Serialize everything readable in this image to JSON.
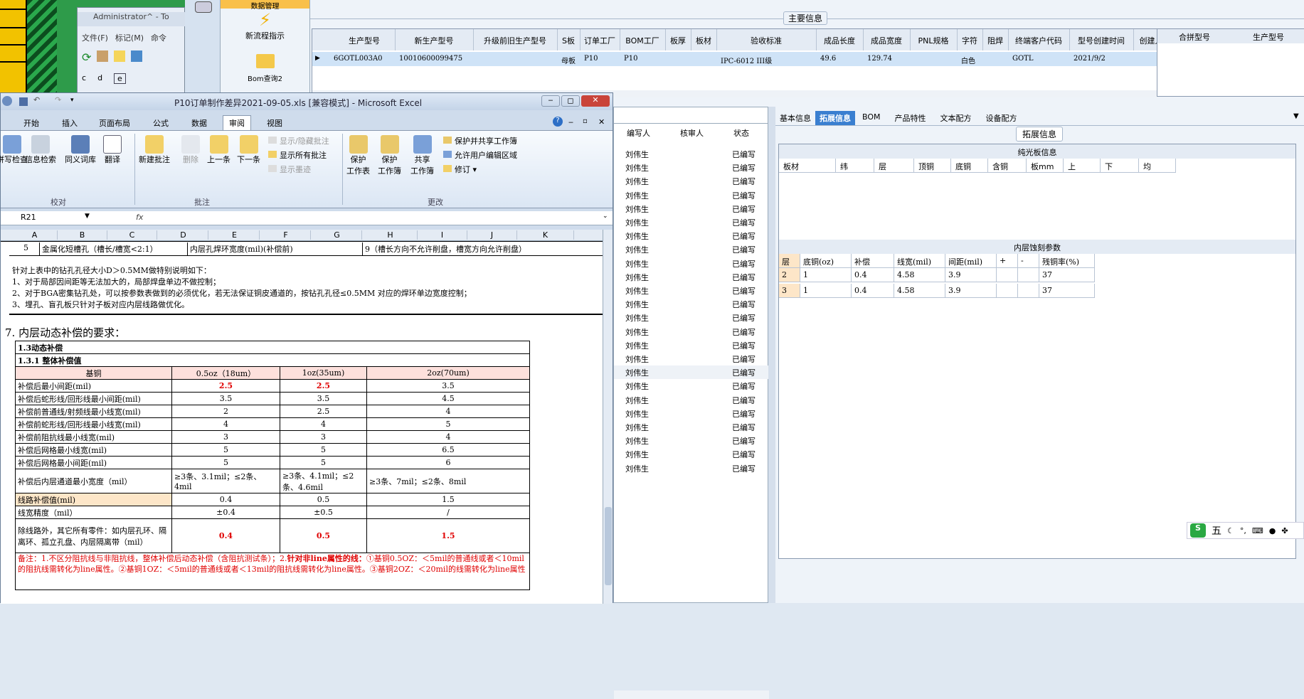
{
  "left_app": {
    "title": "Administrator^ - To",
    "menu": [
      "文件(F)",
      "标记(M)",
      "命令"
    ],
    "drives": [
      "c",
      "d",
      "e"
    ],
    "toolbox": {
      "top": "数据管理",
      "items": [
        "新流程指示",
        "Bom查询2"
      ]
    }
  },
  "main_info": {
    "section_title": "主要信息",
    "headers": [
      "生产型号",
      "新生产型号",
      "升级前旧生产型号",
      "S板",
      "订单工厂",
      "BOM工厂",
      "板厚",
      "板材",
      "验收标准",
      "成品长度",
      "成品宽度",
      "PNL规格",
      "字符",
      "阻焊",
      "终端客户代码",
      "型号创建时间",
      "创建人"
    ],
    "row": [
      "6GOTL003A0",
      "10010600099475",
      "",
      "母板",
      "P10",
      "P10",
      "",
      "",
      "IPC-6012 III级",
      "49.6",
      "129.74",
      "",
      "白色",
      "",
      "GOTL",
      "2021/9/2",
      ""
    ],
    "side_headers": [
      "合拼型号",
      "生产型号"
    ]
  },
  "status_panel": {
    "headers": [
      "编写人",
      "核审人",
      "状态"
    ],
    "writer": "刘伟生",
    "status": "已编写",
    "row_count": 24
  },
  "right_panel": {
    "tabs": [
      "基本信息",
      "拓展信息",
      "BOM",
      "产品特性",
      "文本配方",
      "设备配方"
    ],
    "section_title": "拓展信息",
    "plain_board": {
      "title": "纯光板信息",
      "headers": [
        "板材",
        "纬",
        "层",
        "顶铜",
        "底铜",
        "含铜",
        "板mm",
        "上",
        "下",
        "均"
      ]
    },
    "inner": {
      "title": "内层蚀刻参数",
      "headers": [
        "层",
        "底铜(oz)",
        "补偿",
        "线宽(mil)",
        "间距(mil)",
        "+",
        "-",
        "残铜率(%)"
      ],
      "rows": [
        [
          "2",
          "1",
          "0.4",
          "4.58",
          "3.9",
          "",
          "",
          "37"
        ],
        [
          "3",
          "1",
          "0.4",
          "4.58",
          "3.9",
          "",
          "",
          "37"
        ]
      ]
    }
  },
  "excel": {
    "title": "P10订单制作差异2021-09-05.xls [兼容模式] - Microsoft Excel",
    "tabs": [
      "开始",
      "插入",
      "页面布局",
      "公式",
      "数据",
      "审阅",
      "视图"
    ],
    "active_tab": "审阅",
    "groups": {
      "g1": "校对",
      "g2": "批注",
      "g3": "更改"
    },
    "ribbon": {
      "spell": "拼写检查",
      "research": "信息检索",
      "thesaurus": "同义词库",
      "translate": "翻译",
      "new_comment": "新建批注",
      "delete": "删除",
      "prev": "上一条",
      "next": "下一条",
      "show_hide": "显示/隐藏批注",
      "show_all": "显示所有批注",
      "show_ink": "显示墨迹",
      "protect_sheet": "保护\n工作表",
      "protect_wb": "保护\n工作簿",
      "share_wb": "共享\n工作簿",
      "protect_share": "保护并共享工作簿",
      "allow_edit": "允许用户编辑区域",
      "track": "修订"
    },
    "name_box": "R21",
    "fx": "fx",
    "cols": [
      "A",
      "B",
      "C",
      "D",
      "E",
      "F",
      "G",
      "H",
      "I",
      "J",
      "K"
    ],
    "row5": {
      "num": "5",
      "c1": "金属化短槽孔（槽长/槽宽<2:1）",
      "c2": "内层孔焊环宽度(mil)(补偿前)",
      "c3": "9（槽长方向不允许削盘，槽宽方向允许削盘）"
    },
    "notes": [
      "针对上表中的钻孔孔径大小D＞0.5MM做特别说明如下：",
      "1、对于局部因间距等无法加大的，局部焊盘单边不做控制；",
      "2、对于BGA密集钻孔处，可以按参数表做到的必须优化，若无法保证铜皮通道的，按钻孔孔径≤0.5MM 对应的焊环单边宽度控制；",
      "3、埋孔、盲孔板只针对子板对应内层线路做优化。"
    ],
    "section7": "7. 内层动态补偿的要求：",
    "t_title1": "1.3动态补偿",
    "t_title2": "1.3.1 整体补偿值",
    "t_head": [
      "基铜",
      "0.5oz（18um）",
      "1oz(35um)",
      "2oz(70um)"
    ],
    "t_rows": [
      [
        "补偿后最小间距(mil)",
        "2.5",
        "2.5",
        "3.5"
      ],
      [
        "补偿后蛇形线/回形线最小间距(mil)",
        "3.5",
        "3.5",
        "4.5"
      ],
      [
        "补偿前普通线/射频线最小线宽(mil)",
        "2",
        "2.5",
        "4"
      ],
      [
        "补偿前蛇形线/回形线最小线宽(mil)",
        "4",
        "4",
        "5"
      ],
      [
        "补偿前阻抗线最小线宽(mil)",
        "3",
        "3",
        "4"
      ],
      [
        "补偿后网格最小线宽(mil)",
        "5",
        "5",
        "6.5"
      ],
      [
        "补偿后网格最小间距(mil)",
        "5",
        "5",
        "6"
      ]
    ],
    "t_channel": [
      "补偿后内层通道最小宽度（mil）",
      "≥3条、3.1mil；≤2条、4mil",
      "≥3条、4.1mil；≤2条、4.6mil",
      "≥3条、7mil；≤2条、8mil"
    ],
    "t_line": [
      "线路补偿值(mil)",
      "0.4",
      "0.5",
      "1.5"
    ],
    "t_prec": [
      "线宽精度（mil）",
      "±0.4",
      "±0.5",
      "/"
    ],
    "t_other": [
      "除线路外，其它所有零件：如内层孔环、隔离环、孤立孔盘、内层隔离带（mil）",
      "0.4",
      "0.5",
      "1.5"
    ],
    "remark_a": "备注：1.不区分阻抗线与非阻抗线，整体补偿后动态补偿（含阻抗测试条）；2.",
    "remark_b": "针对非line属性的线：",
    "remark_c": "①基铜0.5OZ：＜5mil的普通线或者＜10mil的阻抗线需转化为line属性。②基铜1OZ：＜5mil的普通线或者＜13mil的阻抗线需转化为line属性。③基铜2OZ：＜20mil的线需转化为line属性"
  },
  "ime": {
    "label": "五",
    "glyph": "S"
  }
}
